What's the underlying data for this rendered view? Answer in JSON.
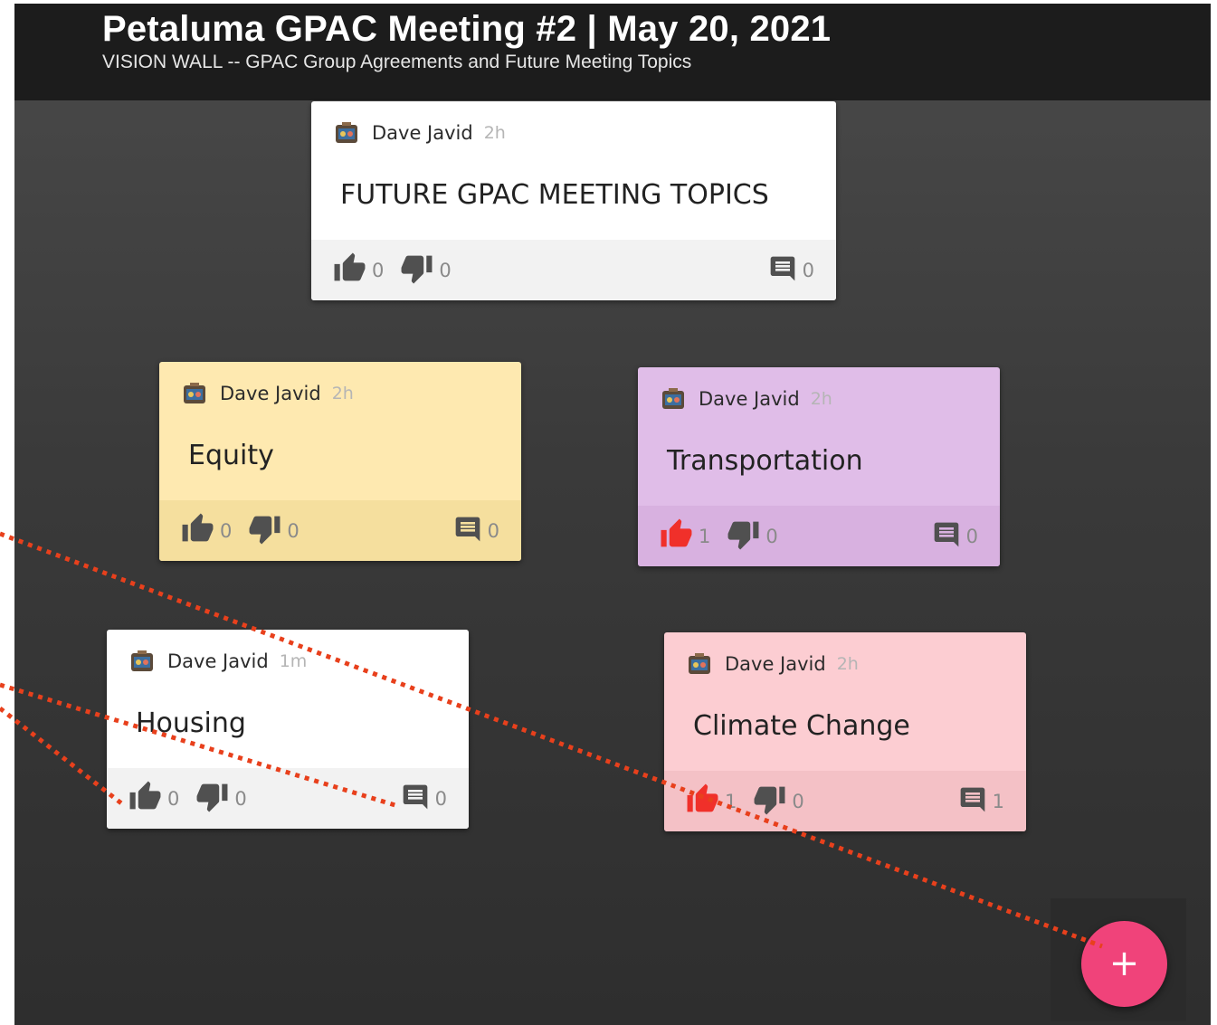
{
  "header": {
    "title": "Petaluma GPAC Meeting #2 | May 20, 2021",
    "subtitle": "VISION WALL -- GPAC Group Agreements and Future Meeting Topics"
  },
  "colors": {
    "board_background": "#3a3a3a",
    "header_background": "#1c1c1c",
    "accent_fab": "#f0437a",
    "liked_thumb": "#f0302a",
    "annotation_dots": "#e8401c"
  },
  "cards": [
    {
      "author": "Dave Javid",
      "age": "2h",
      "text": "FUTURE GPAC MEETING TOPICS",
      "likes": "0",
      "dislikes": "0",
      "comments": "0",
      "liked": false,
      "body_color": "#ffffff",
      "footer_color": "#f2f2f2"
    },
    {
      "author": "Dave Javid",
      "age": "2h",
      "text": "Equity",
      "likes": "0",
      "dislikes": "0",
      "comments": "0",
      "liked": false,
      "body_color": "#fee9b0",
      "footer_color": "#f5df9e"
    },
    {
      "author": "Dave Javid",
      "age": "2h",
      "text": "Transportation",
      "likes": "1",
      "dislikes": "0",
      "comments": "0",
      "liked": true,
      "body_color": "#e0bde8",
      "footer_color": "#d8b1e0"
    },
    {
      "author": "Dave Javid",
      "age": "1m",
      "text": "Housing",
      "likes": "0",
      "dislikes": "0",
      "comments": "0",
      "liked": false,
      "body_color": "#ffffff",
      "footer_color": "#f2f2f2"
    },
    {
      "author": "Dave Javid",
      "age": "2h",
      "text": "Climate Change",
      "likes": "1",
      "dislikes": "0",
      "comments": "1",
      "liked": true,
      "body_color": "#fccdd2",
      "footer_color": "#f4c1c6"
    }
  ],
  "fab": {
    "label": "+"
  },
  "icons": [
    "avatar-icon",
    "thumbs-up-icon",
    "thumbs-down-icon",
    "comment-icon",
    "plus-icon"
  ]
}
